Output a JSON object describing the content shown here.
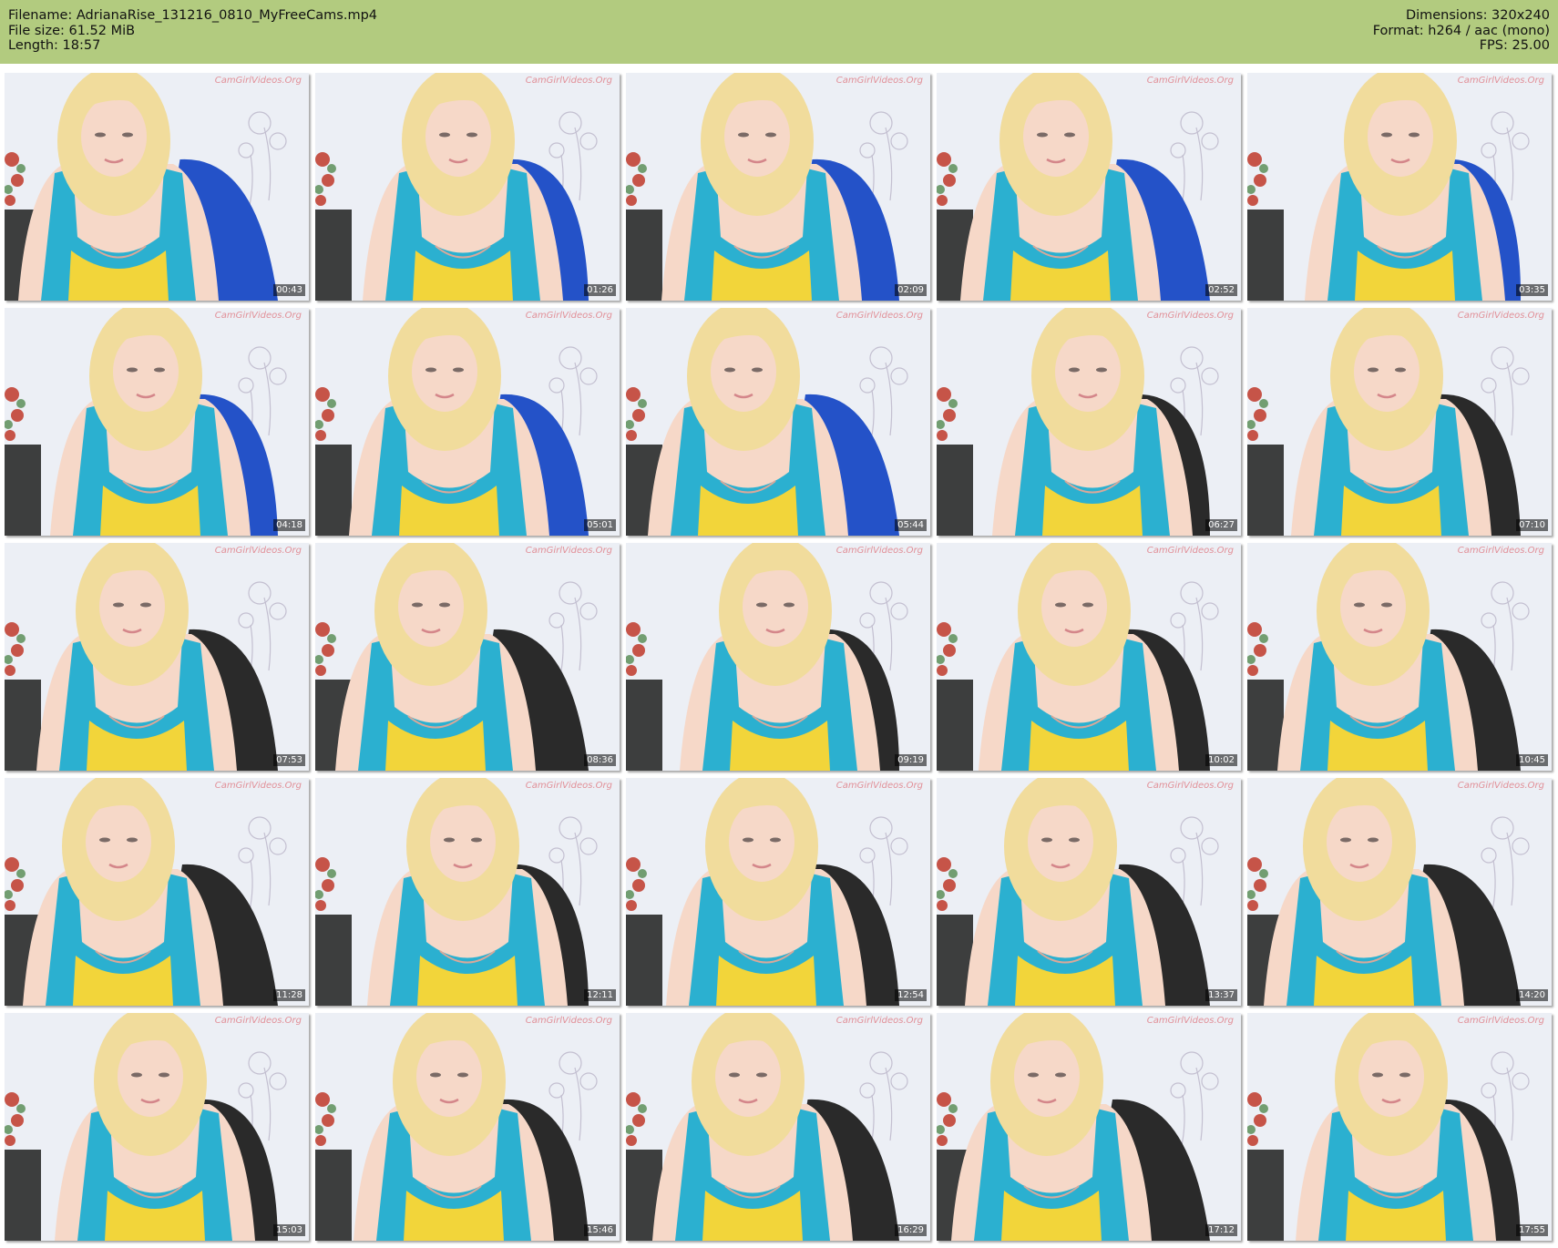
{
  "header": {
    "filename_line": "Filename: AdrianaRise_131216_0810_MyFreeCams.mp4",
    "filesize_line": "File size: 61.52 MiB",
    "length_line": "Length: 18:57",
    "dimensions_line": "Dimensions: 320x240",
    "format_line": "Format: h264 / aac (mono)",
    "fps_line": "FPS: 25.00"
  },
  "thumbnail_watermark": "CamGirlVideos.Org",
  "thumbnails": [
    "00:43",
    "01:26",
    "02:09",
    "02:52",
    "03:35",
    "04:18",
    "05:01",
    "05:44",
    "06:27",
    "07:10",
    "07:53",
    "08:36",
    "09:19",
    "10:02",
    "10:45",
    "11:28",
    "12:11",
    "12:54",
    "13:37",
    "14:20",
    "15:03",
    "15:46",
    "16:29",
    "17:12",
    "17:55"
  ],
  "colors": {
    "header_bg": "#b2cb7f",
    "top_teal": "#2bb0d0",
    "top_yellow": "#f2d53a",
    "hair": "#f1dc9c",
    "skin": "#f6d8c8",
    "wall": "#eceff5",
    "chair": "#2a2a2a",
    "chair_blue": "#2452c8"
  }
}
